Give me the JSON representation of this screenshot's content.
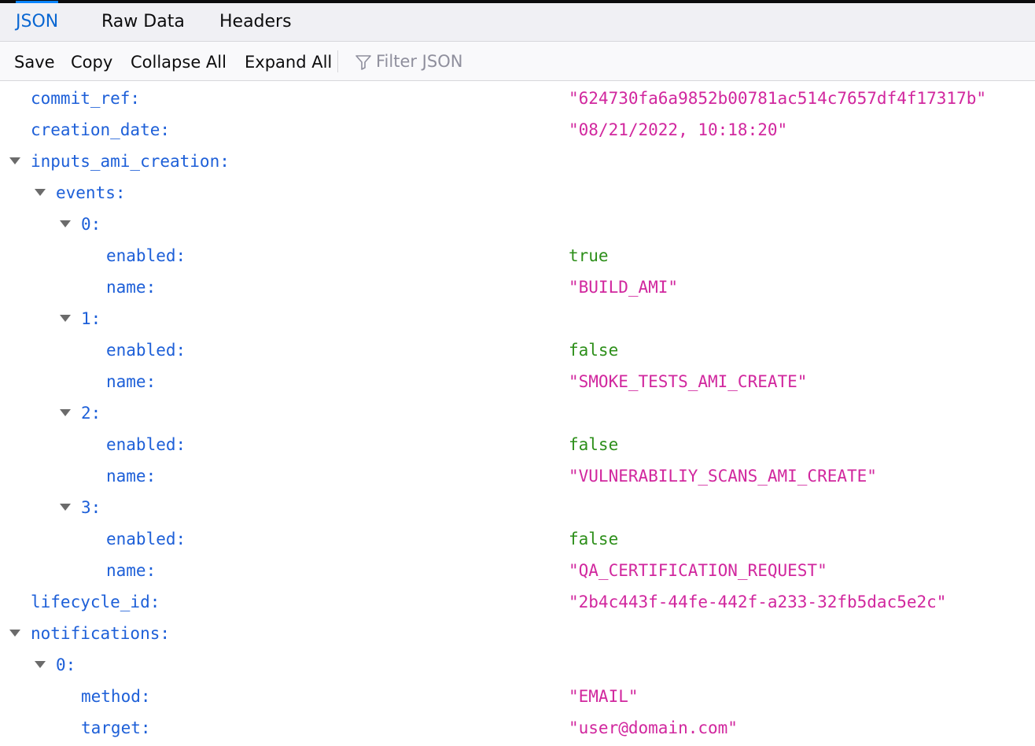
{
  "tabs": [
    {
      "label": "JSON",
      "active": true
    },
    {
      "label": "Raw Data",
      "active": false
    },
    {
      "label": "Headers",
      "active": false
    }
  ],
  "toolbar": {
    "save": "Save",
    "copy": "Copy",
    "collapse_all": "Collapse All",
    "expand_all": "Expand All",
    "filter_placeholder": "Filter JSON",
    "filter_icon": "filter-icon"
  },
  "colors": {
    "key": "#1d5fd8",
    "string": "#d1279e",
    "boolean": "#2d8f1a",
    "active_tab": "#0a67d2"
  },
  "rows": [
    {
      "key": "commit_ref:",
      "value": "\"624730fa6a9852b00781ac514c7657df4f17317b\"",
      "type": "string",
      "depth": 0,
      "expanded": null
    },
    {
      "key": "creation_date:",
      "value": "\"08/21/2022, 10:18:20\"",
      "type": "string",
      "depth": 0,
      "expanded": null
    },
    {
      "key": "inputs_ami_creation:",
      "value": "",
      "type": "object",
      "depth": 0,
      "expanded": true
    },
    {
      "key": "events:",
      "value": "",
      "type": "array",
      "depth": 1,
      "expanded": true
    },
    {
      "key": "0:",
      "value": "",
      "type": "object",
      "depth": 2,
      "expanded": true
    },
    {
      "key": "enabled:",
      "value": "true",
      "type": "boolean",
      "depth": 3,
      "expanded": null
    },
    {
      "key": "name:",
      "value": "\"BUILD_AMI\"",
      "type": "string",
      "depth": 3,
      "expanded": null
    },
    {
      "key": "1:",
      "value": "",
      "type": "object",
      "depth": 2,
      "expanded": true
    },
    {
      "key": "enabled:",
      "value": "false",
      "type": "boolean",
      "depth": 3,
      "expanded": null
    },
    {
      "key": "name:",
      "value": "\"SMOKE_TESTS_AMI_CREATE\"",
      "type": "string",
      "depth": 3,
      "expanded": null
    },
    {
      "key": "2:",
      "value": "",
      "type": "object",
      "depth": 2,
      "expanded": true
    },
    {
      "key": "enabled:",
      "value": "false",
      "type": "boolean",
      "depth": 3,
      "expanded": null
    },
    {
      "key": "name:",
      "value": "\"VULNERABILIY_SCANS_AMI_CREATE\"",
      "type": "string",
      "depth": 3,
      "expanded": null
    },
    {
      "key": "3:",
      "value": "",
      "type": "object",
      "depth": 2,
      "expanded": true
    },
    {
      "key": "enabled:",
      "value": "false",
      "type": "boolean",
      "depth": 3,
      "expanded": null
    },
    {
      "key": "name:",
      "value": "\"QA_CERTIFICATION_REQUEST\"",
      "type": "string",
      "depth": 3,
      "expanded": null
    },
    {
      "key": "lifecycle_id:",
      "value": "\"2b4c443f-44fe-442f-a233-32fb5dac5e2c\"",
      "type": "string",
      "depth": 0,
      "expanded": null
    },
    {
      "key": "notifications:",
      "value": "",
      "type": "array",
      "depth": 0,
      "expanded": true
    },
    {
      "key": "0:",
      "value": "",
      "type": "object",
      "depth": 1,
      "expanded": true
    },
    {
      "key": "method:",
      "value": "\"EMAIL\"",
      "type": "string",
      "depth": 2,
      "expanded": null
    },
    {
      "key": "target:",
      "value": "\"user@domain.com\"",
      "type": "string",
      "depth": 2,
      "expanded": null
    }
  ]
}
